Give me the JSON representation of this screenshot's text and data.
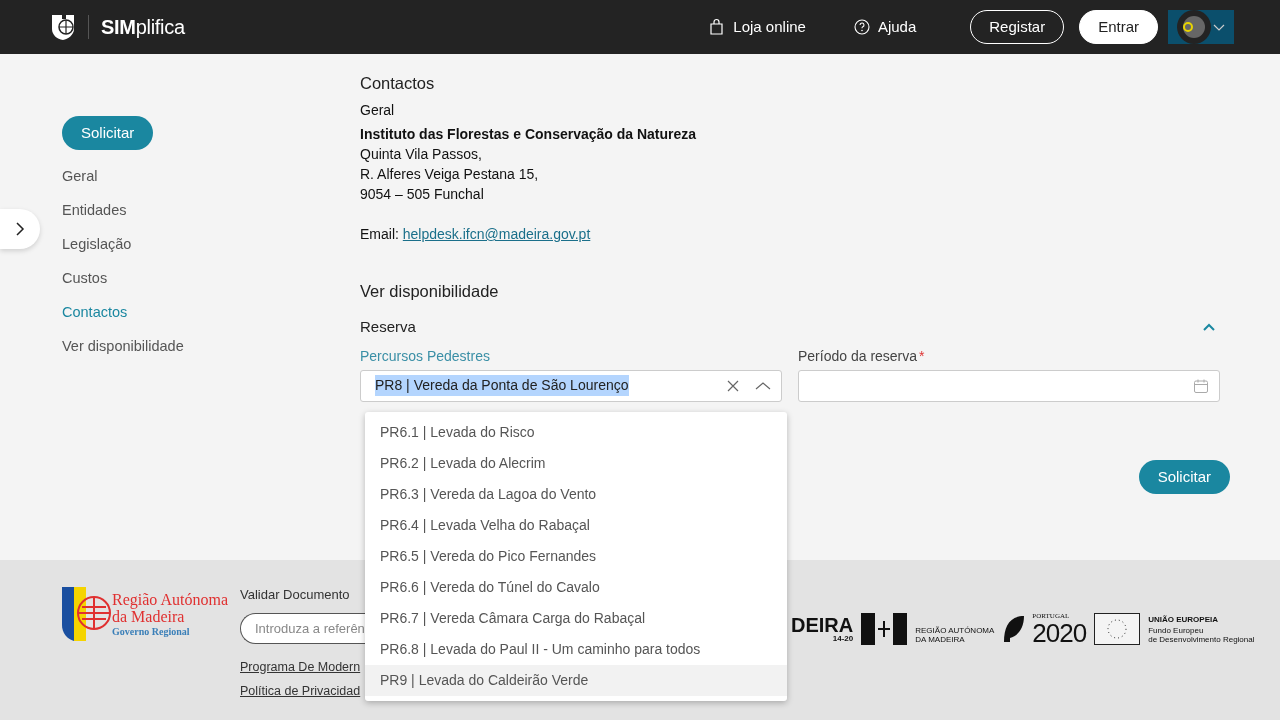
{
  "header": {
    "brand": "IMplifica",
    "brand_prefix": "S",
    "links": [
      {
        "kind": "bag",
        "label": "Loja online"
      },
      {
        "kind": "help",
        "label": "Ajuda"
      }
    ],
    "buttons": [
      {
        "kind": "outline",
        "label": "Registar"
      },
      {
        "kind": "solid",
        "label": "Entrar"
      }
    ]
  },
  "sidebar": {
    "action": "Solicitar",
    "items": [
      {
        "label": "Geral",
        "selected": false
      },
      {
        "label": "Entidades",
        "selected": false
      },
      {
        "label": "Legislação",
        "selected": false
      },
      {
        "label": "Custos",
        "selected": false
      },
      {
        "label": "Contactos",
        "selected": true
      },
      {
        "label": "Ver disponibilidade",
        "selected": false
      }
    ]
  },
  "contacts": {
    "title": "Contactos",
    "subtitle": "Geral",
    "org": "Instituto das Florestas e Conservação da Natureza",
    "address": [
      "Quinta Vila Passos,",
      "R. Alferes Veiga Pestana 15,",
      "9054 – 505 Funchal"
    ],
    "email_label": "Email:",
    "email": "helpdesk.ifcn@madeira.gov.pt"
  },
  "availability": {
    "title": "Ver disponibilidade",
    "section": {
      "label": "Reserva",
      "expanded": true
    },
    "trail_field": {
      "label": "Percursos Pedestres",
      "value": "PR8 | Vereda da Ponta de São Lourenço",
      "open": true
    },
    "period_field": {
      "label": "Período da reserva",
      "required_mark": "*"
    },
    "options": [
      {
        "label": "PR6.1 | Levada do Risco",
        "highlighted": false
      },
      {
        "label": "PR6.2 | Levada do Alecrim",
        "highlighted": false
      },
      {
        "label": "PR6.3 | Vereda da Lagoa do Vento",
        "highlighted": false
      },
      {
        "label": "PR6.4 | Levada Velha do Rabaçal",
        "highlighted": false
      },
      {
        "label": "PR6.5 | Vereda do Pico Fernandes",
        "highlighted": false
      },
      {
        "label": "PR6.6 | Vereda do Túnel do Cavalo",
        "highlighted": false
      },
      {
        "label": "PR6.7 | Vereda Câmara Carga do Rabaçal",
        "highlighted": false
      },
      {
        "label": "PR6.8 | Levada do Paul II - Um caminho para todos",
        "highlighted": false
      },
      {
        "label": "PR9 | Levada do Caldeirão Verde",
        "highlighted": true
      }
    ],
    "submit": "Solicitar"
  },
  "footer": {
    "region_logo": [
      "Região Autónoma",
      "da Madeira",
      "Governo Regional"
    ],
    "validate_label": "Validar Documento",
    "validate_placeholder": "Introduza a referên",
    "links": [
      "Programa De Modern",
      "Política de Privacidad"
    ],
    "partner_logos": [
      {
        "kind": "madeira1420",
        "texts": [
          "DEIRA",
          "14-20"
        ]
      },
      {
        "kind": "ram",
        "texts": [
          "REGIÃO AUTÓNOMA",
          "DA MADEIRA"
        ]
      },
      {
        "kind": "pt2020",
        "texts": [
          "PORTUGAL",
          "2020"
        ]
      },
      {
        "kind": "eu",
        "texts": [
          "UNIÃO EUROPEIA",
          "Fundo Europeu",
          "de Desenvolvimento Regional"
        ]
      }
    ]
  }
}
